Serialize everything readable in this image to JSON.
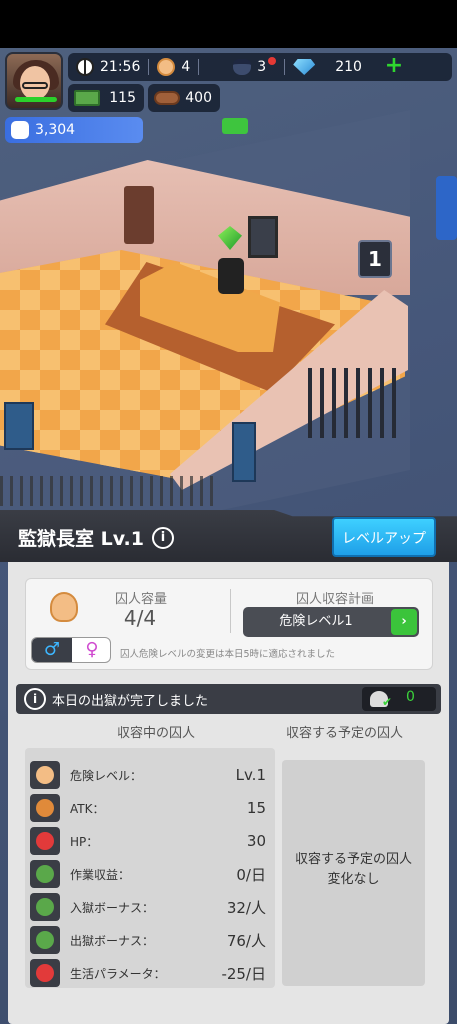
{
  "hud": {
    "time": "21:56",
    "inmates_count": "4",
    "guards_count": "3",
    "gems": "210",
    "cash": "115",
    "wood": "400",
    "power": "3,304",
    "plus_symbol": "+"
  },
  "room_sign": {
    "level": "1"
  },
  "panel": {
    "title": "監獄長室 Lv.1",
    "info_symbol": "i",
    "level_up_button": "レベルアップ"
  },
  "capacity": {
    "label": "囚人容量",
    "value": "4/4",
    "plan_label": "囚人収容計画",
    "danger_select": "危険レベル1",
    "danger_arrow": "›",
    "male_symbol": "♂",
    "female_symbol": "♀",
    "notice": "囚人危険レベルの変更は本日5時に適応されました"
  },
  "release": {
    "message": "本日の出獄が完了しました",
    "count": "0",
    "check": "✔"
  },
  "columns": {
    "current": "収容中の囚人",
    "planned": "収容する予定の囚人"
  },
  "stats": [
    {
      "icon": "inmate-icon",
      "label": "危険レベル：",
      "value": "Lv.1",
      "color": "#f3bd85"
    },
    {
      "icon": "muscle-icon",
      "label": "ATK：",
      "value": "15",
      "color": "#e08a3a"
    },
    {
      "icon": "blood-drop-icon",
      "label": "HP：",
      "value": "30",
      "color": "#e23a3a"
    },
    {
      "icon": "cash-icon",
      "label": "作業収益：",
      "value": "0/日",
      "color": "#5aa84a"
    },
    {
      "icon": "cash-icon",
      "label": "入獄ボーナス：",
      "value": "32/人",
      "color": "#5aa84a"
    },
    {
      "icon": "cash-icon",
      "label": "出獄ボーナス：",
      "value": "76/人",
      "color": "#5aa84a"
    },
    {
      "icon": "angry-face-icon",
      "label": "生活パラメータ：",
      "value": "-25/日",
      "color": "#e23a3a"
    }
  ],
  "planned": {
    "text": "収容する予定の囚人\n変化なし"
  }
}
